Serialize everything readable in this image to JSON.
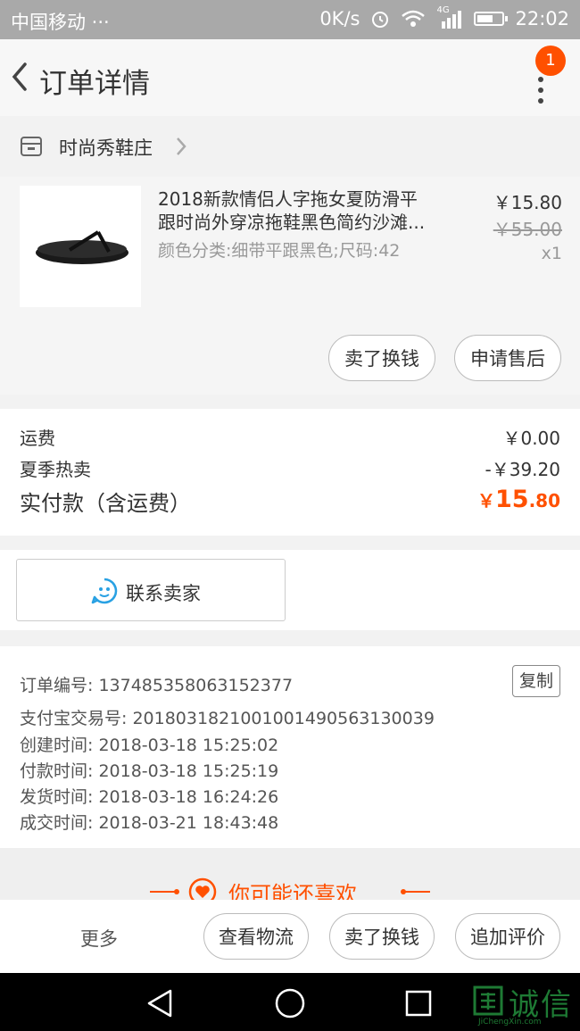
{
  "status_bar": {
    "carrier": "中国移动 ···",
    "speed": "0K/s",
    "network": "4G",
    "time": "22:02"
  },
  "header": {
    "title": "订单详情",
    "badge_count": "1"
  },
  "shop": {
    "name": "时尚秀鞋庄"
  },
  "product": {
    "title_line1": "2018新款情侣人字拖女夏防滑平",
    "title_line2": "跟时尚外穿凉拖鞋黑色简约沙滩...",
    "sku": "颜色分类:细带平跟黑色;尺码:42",
    "price": "￥15.80",
    "original_price": "￥55.00",
    "quantity": "x1",
    "btn_sell": "卖了换钱",
    "btn_aftersale": "申请售后"
  },
  "fees": {
    "shipping_label": "运费",
    "shipping_value": "￥0.00",
    "promo_label": "夏季热卖",
    "promo_value": "-￥39.20",
    "total_label": "实付款（含运费）",
    "total_currency": "￥",
    "total_int": "15",
    "total_dec": ".80"
  },
  "contact": {
    "label": "联系卖家"
  },
  "order_info": {
    "copy_label": "复制",
    "lines": [
      "订单编号: 1374853580631523​77",
      "支付宝交易号: 2018031821001001490563130039",
      "创建时间: 2018-03-18 15:25:02",
      "付款时间: 2018-03-18 15:25:19",
      "发货时间: 2018-03-18 16:24:26",
      "成交时间: 2018-03-21 18:43:48"
    ]
  },
  "recommend": {
    "title": "你可能还喜欢"
  },
  "bottom_bar": {
    "more": "更多",
    "logistics": "查看物流",
    "sell": "卖了换钱",
    "review": "追加评价"
  },
  "watermark": {
    "text": "诚信",
    "sub": "JiChengXin.com"
  },
  "colors": {
    "accent": "#ff5000",
    "status_bar": "#a9a9a9",
    "nav_bar": "#000000",
    "contact_icon": "#29a1e3"
  }
}
